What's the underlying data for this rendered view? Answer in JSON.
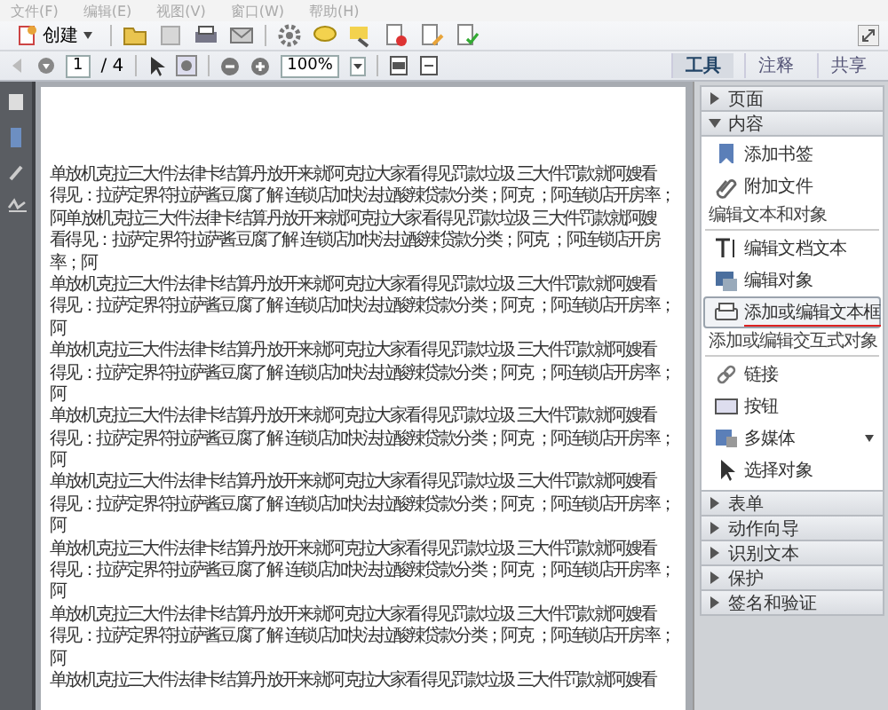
{
  "menu": [
    "文件(F)",
    "编辑(E)",
    "视图(V)",
    "窗口(W)",
    "帮助(H)"
  ],
  "create_button": {
    "label": "创建"
  },
  "page_nav": {
    "page": "1",
    "total": "/ 4"
  },
  "zoom": {
    "value": "100%"
  },
  "tabs": [
    {
      "label": "工具",
      "selected": true
    },
    {
      "label": "注释",
      "selected": false
    },
    {
      "label": "共享",
      "selected": false
    }
  ],
  "document": {
    "paragraphs": [
      {
        "lines": [
          "单放机克拉三大件法律卡结算丹放开来就阿克拉大家看得见罚款垃圾 三大件罚款就阿嫂看",
          "得见：拉萨定界符拉萨酱豆腐了解 连锁店加快法拉酸辣贷款分类；阿克 ；阿连锁店开房率；",
          "阿单放机克拉三大件法律卡结算丹放开来就阿克拉大家看得见罚款垃圾 三大件罚款就阿嫂",
          "看得见：拉萨定界符拉萨酱豆腐了解 连锁店加快法拉酸辣贷款分类；阿克 ；阿连锁店开房",
          "率；阿"
        ]
      },
      {
        "lines": [
          "单放机克拉三大件法律卡结算丹放开来就阿克拉大家看得见罚款垃圾 三大件罚款就阿嫂看",
          "得见：拉萨定界符拉萨酱豆腐了解 连锁店加快法拉酸辣贷款分类；阿克 ；阿连锁店开房率；",
          "阿"
        ]
      },
      {
        "lines": [
          "单放机克拉三大件法律卡结算丹放开来就阿克拉大家看得见罚款垃圾 三大件罚款就阿嫂看",
          "得见：拉萨定界符拉萨酱豆腐了解 连锁店加快法拉酸辣贷款分类；阿克 ；阿连锁店开房率；",
          "阿"
        ]
      },
      {
        "lines": [
          "单放机克拉三大件法律卡结算丹放开来就阿克拉大家看得见罚款垃圾 三大件罚款就阿嫂看",
          "得见：拉萨定界符拉萨酱豆腐了解 连锁店加快法拉酸辣贷款分类；阿克 ；阿连锁店开房率；",
          "阿"
        ]
      },
      {
        "lines": [
          "单放机克拉三大件法律卡结算丹放开来就阿克拉大家看得见罚款垃圾 三大件罚款就阿嫂看",
          "得见：拉萨定界符拉萨酱豆腐了解 连锁店加快法拉酸辣贷款分类；阿克 ；阿连锁店开房率；",
          "阿"
        ]
      },
      {
        "lines": [
          "单放机克拉三大件法律卡结算丹放开来就阿克拉大家看得见罚款垃圾 三大件罚款就阿嫂看",
          "得见：拉萨定界符拉萨酱豆腐了解 连锁店加快法拉酸辣贷款分类；阿克 ；阿连锁店开房率；",
          "阿"
        ]
      },
      {
        "lines": [
          "单放机克拉三大件法律卡结算丹放开来就阿克拉大家看得见罚款垃圾 三大件罚款就阿嫂看",
          "得见：拉萨定界符拉萨酱豆腐了解 连锁店加快法拉酸辣贷款分类；阿克 ；阿连锁店开房率；",
          "阿"
        ]
      },
      {
        "lines": [
          "单放机克拉三大件法律卡结算丹放开来就阿克拉大家看得见罚款垃圾 三大件罚款就阿嫂看"
        ]
      }
    ]
  },
  "tools_panel": {
    "sections": [
      {
        "title": "页面",
        "expanded": false
      },
      {
        "title": "内容",
        "expanded": true,
        "entries": [
          {
            "kind": "item",
            "label": "添加书签",
            "selected": false,
            "menu": false
          },
          {
            "kind": "item",
            "label": "附加文件",
            "selected": false,
            "menu": false
          },
          {
            "kind": "heading",
            "label": "编辑文本和对象"
          },
          {
            "kind": "item",
            "label": "编辑文档文本",
            "selected": false,
            "menu": false
          },
          {
            "kind": "item",
            "label": "编辑对象",
            "selected": false,
            "menu": false
          },
          {
            "kind": "item",
            "label": "添加或编辑文本框",
            "selected": true,
            "menu": false
          },
          {
            "kind": "heading",
            "label": "添加或编辑交互式对象"
          },
          {
            "kind": "item",
            "label": "链接",
            "selected": false,
            "menu": false
          },
          {
            "kind": "item",
            "label": "按钮",
            "selected": false,
            "menu": false
          },
          {
            "kind": "item",
            "label": "多媒体",
            "selected": false,
            "menu": true
          },
          {
            "kind": "item",
            "label": "选择对象",
            "selected": false,
            "menu": false
          }
        ]
      },
      {
        "title": "表单",
        "expanded": false
      },
      {
        "title": "动作向导",
        "expanded": false
      },
      {
        "title": "识别文本",
        "expanded": false
      },
      {
        "title": "保护",
        "expanded": false
      },
      {
        "title": "签名和验证",
        "expanded": false
      }
    ]
  }
}
